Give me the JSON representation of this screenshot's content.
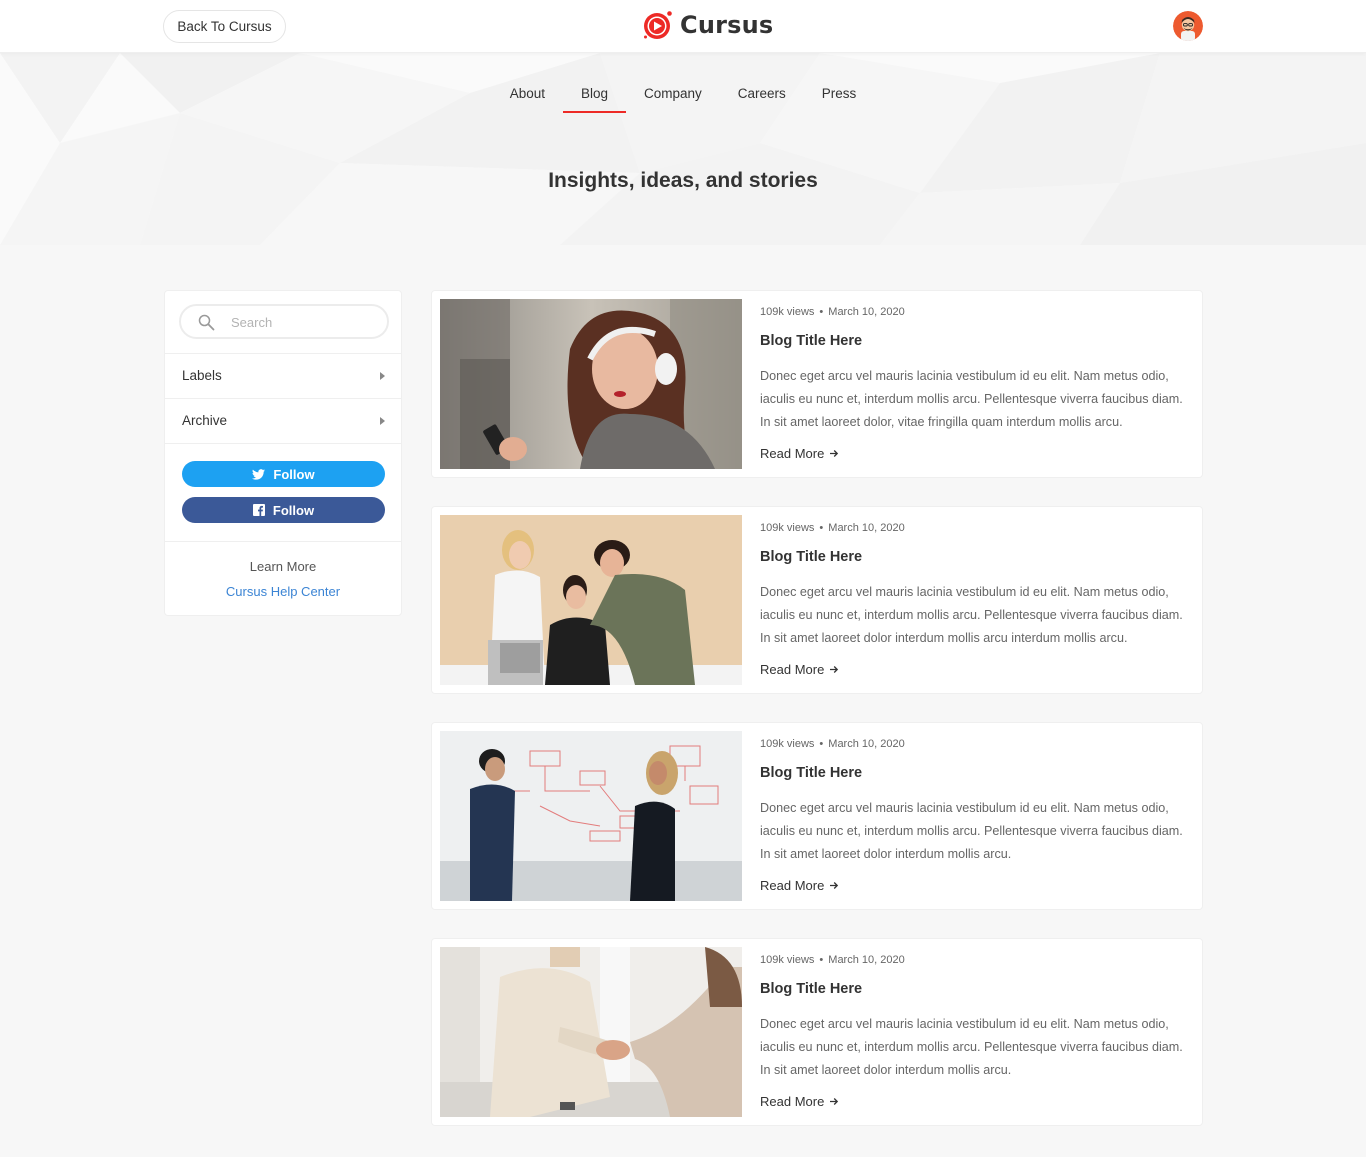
{
  "header": {
    "back_label": "Back To Cursus",
    "brand": "Cursus"
  },
  "nav": {
    "items": [
      {
        "label": "About",
        "active": false
      },
      {
        "label": "Blog",
        "active": true
      },
      {
        "label": "Company",
        "active": false
      },
      {
        "label": "Careers",
        "active": false
      },
      {
        "label": "Press",
        "active": false
      }
    ]
  },
  "hero": {
    "title": "Insights, ideas, and stories"
  },
  "sidebar": {
    "search_placeholder": "Search",
    "labels": "Labels",
    "archive": "Archive",
    "twitter_follow": "Follow",
    "facebook_follow": "Follow",
    "learn_more": "Learn More",
    "help_center": "Cursus Help Center"
  },
  "posts": [
    {
      "views": "109k views",
      "date": "March 10, 2020",
      "title": "Blog Title Here",
      "excerpt": "Donec eget arcu vel mauris lacinia vestibulum id eu elit. Nam metus odio, iaculis eu nunc et, interdum mollis arcu. Pellentesque viverra faucibus diam. In sit amet laoreet dolor, vitae fringilla quam interdum mollis arcu.",
      "read_more": "Read More"
    },
    {
      "views": "109k views",
      "date": "March 10, 2020",
      "title": "Blog Title Here",
      "excerpt": "Donec eget arcu vel mauris lacinia vestibulum id eu elit. Nam metus odio, iaculis eu nunc et, interdum mollis arcu. Pellentesque viverra faucibus diam. In sit amet laoreet dolor interdum mollis arcu interdum mollis arcu.",
      "read_more": "Read More"
    },
    {
      "views": "109k views",
      "date": "March 10, 2020",
      "title": "Blog Title Here",
      "excerpt": "Donec eget arcu vel mauris lacinia vestibulum id eu elit. Nam metus odio, iaculis eu nunc et, interdum mollis arcu. Pellentesque viverra faucibus diam. In sit amet laoreet dolor interdum mollis arcu.",
      "read_more": "Read More"
    },
    {
      "views": "109k views",
      "date": "March 10, 2020",
      "title": "Blog Title Here",
      "excerpt": "Donec eget arcu vel mauris lacinia vestibulum id eu elit. Nam metus odio, iaculis eu nunc et, interdum mollis arcu. Pellentesque viverra faucibus diam. In sit amet laoreet dolor interdum mollis arcu.",
      "read_more": "Read More"
    }
  ],
  "colors": {
    "accent": "#ed2a26",
    "twitter": "#1da1f2",
    "facebook": "#3b5998",
    "link": "#3b84d4"
  }
}
